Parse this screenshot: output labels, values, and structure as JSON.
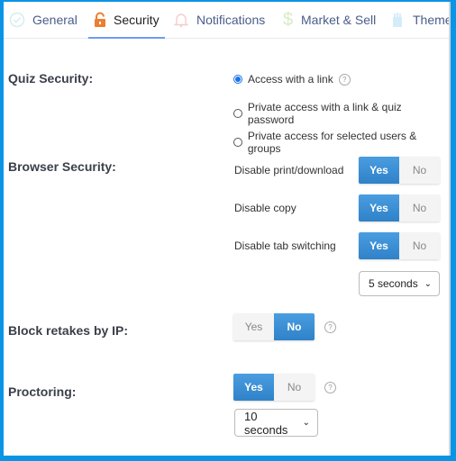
{
  "tabs": [
    {
      "label": "General",
      "icon": "check-circle-icon",
      "active": false
    },
    {
      "label": "Security",
      "icon": "lock-icon",
      "active": true
    },
    {
      "label": "Notifications",
      "icon": "bell-icon",
      "active": false
    },
    {
      "label": "Market & Sell",
      "icon": "dollar-icon",
      "active": false
    },
    {
      "label": "Theme",
      "icon": "brush-icon",
      "active": false
    }
  ],
  "quiz_security": {
    "label": "Quiz Security:",
    "options": [
      {
        "label": "Access with a link",
        "selected": true
      },
      {
        "label": "Private access with a link & quiz password",
        "selected": false
      },
      {
        "label": "Private access for selected users & groups",
        "selected": false
      }
    ]
  },
  "browser_security": {
    "label": "Browser Security:",
    "settings": [
      {
        "label": "Disable print/download",
        "value": "Yes"
      },
      {
        "label": "Disable copy",
        "value": "Yes"
      },
      {
        "label": "Disable tab switching",
        "value": "Yes"
      }
    ],
    "tab_switch_timeout": "5 seconds"
  },
  "block_retakes": {
    "label": "Block retakes by IP:",
    "value": "No"
  },
  "proctoring": {
    "label": "Proctoring:",
    "value": "Yes",
    "interval": "10 seconds"
  },
  "toggle_labels": {
    "yes": "Yes",
    "no": "No"
  },
  "help_glyph": "?",
  "chevron_glyph": "⌄"
}
